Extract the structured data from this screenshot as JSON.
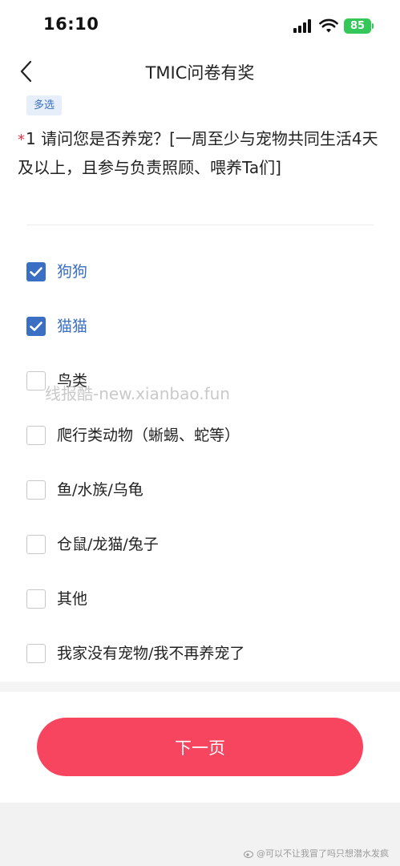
{
  "status_bar": {
    "time": "16:10",
    "battery": "85"
  },
  "nav": {
    "title": "TMIC问卷有奖"
  },
  "question": {
    "tag": "多选",
    "required_mark": "*",
    "text": "1 请问您是否养宠？[一周至少与宠物共同生活4天及以上，且参与负责照顾、喂养Ta们]",
    "options": [
      {
        "label": "狗狗",
        "checked": true
      },
      {
        "label": "猫猫",
        "checked": true
      },
      {
        "label": "鸟类",
        "checked": false
      },
      {
        "label": "爬行类动物（蜥蜴、蛇等）",
        "checked": false
      },
      {
        "label": "鱼/水族/乌龟",
        "checked": false
      },
      {
        "label": "仓鼠/龙猫/兔子",
        "checked": false
      },
      {
        "label": "其他",
        "checked": false
      },
      {
        "label": "我家没有宠物/我不再养宠了",
        "checked": false
      }
    ]
  },
  "watermark": "线报酷-new.xianbao.fun",
  "footer": {
    "next_button": "下一页"
  },
  "credit": "@可以不让我冒了吗只想潜水发疯",
  "colors": {
    "accent": "#3a6fc4",
    "primary_button": "#f7455f",
    "required": "#e5364a",
    "battery": "#34c759"
  }
}
